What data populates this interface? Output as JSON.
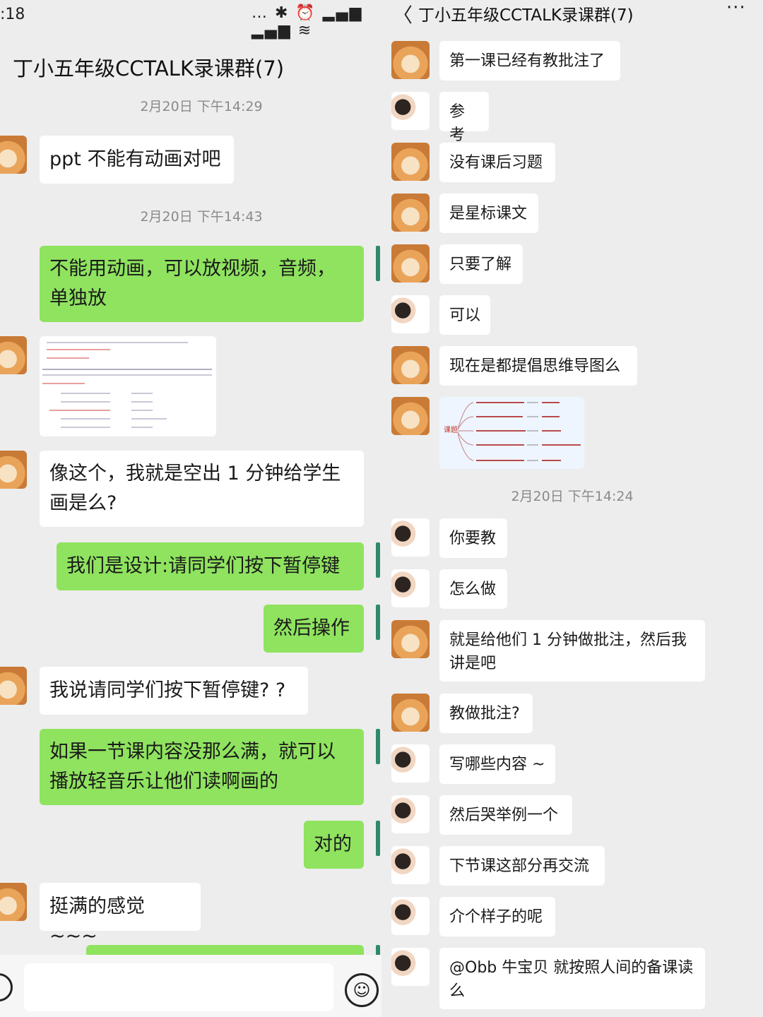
{
  "left": {
    "status_time": ":18",
    "status_icons": "… ✱ ⏰ ▂▄▆ ▂▄▆ ≋",
    "title": "丁小五年级CCTALK录课群(7)",
    "ts1": "2月20日 下午14:29",
    "ts2": "2月20日 下午14:43",
    "messages": [
      "ppt 不能有动画对吧",
      "不能用动画，可以放视频，音频，单独放",
      "像这个，我就是空出 1 分钟给学生画是么?",
      "我们是设计:请同学们按下暂停键",
      "然后操作",
      "我说请同学们按下暂停键? ?",
      "如果一节课内容没那么满，就可以播放轻音乐让他们读啊画的",
      "对的",
      "挺满的感觉 ~~~"
    ],
    "emoji_glyph": "☺"
  },
  "right": {
    "back_glyph": "〈",
    "title": "丁小五年级CCTALK录课群(7)",
    "more_glyph": "···",
    "ts": "2月20日 下午14:24",
    "messages": [
      "第一课已经有教批注了",
      "参考",
      "没有课后习题",
      "是星标课文",
      "只要了解",
      "可以",
      "现在是都提倡思维导图么",
      "你要教",
      "怎么做",
      "就是给他们 1 分钟做批注，然后我讲是吧",
      "教做批注?",
      "写哪些内容 ~",
      "然后哭举例一个",
      "下节课这部分再交流",
      "介个样子的呢",
      "@Obb 牛宝贝   就按照人间的备课读么"
    ],
    "mindmap_root": "课题"
  }
}
